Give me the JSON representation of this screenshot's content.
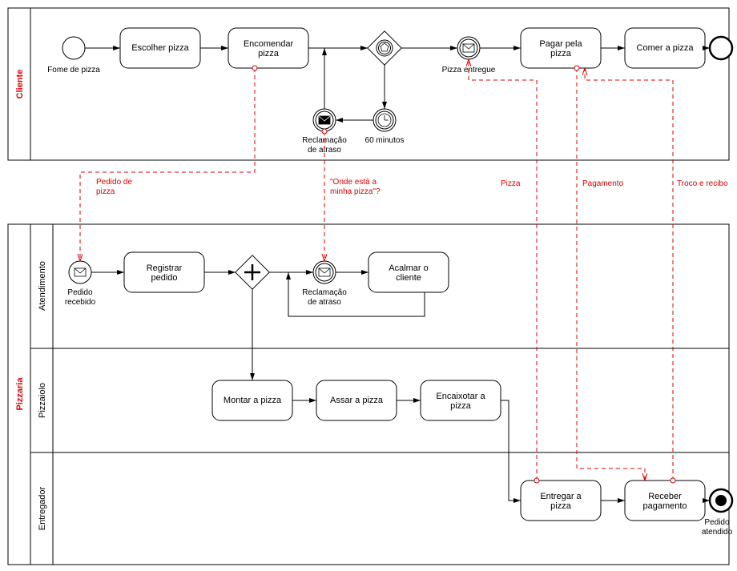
{
  "pool1": {
    "name": "Cliente"
  },
  "pool2": {
    "name": "Pizzaria"
  },
  "lanes": {
    "atendimento": "Atendimento",
    "pizzaiolo": "Pizzaiolo",
    "entregador": "Entregador"
  },
  "events": {
    "fome": "Fome de pizza",
    "pizzaEntregue": "Pizza entregue",
    "reclamacaoCliente1": "Reclamação",
    "reclamacaoCliente2": "de atraso",
    "timer": "60 minutos",
    "pedidoRecebido1": "Pedido",
    "pedidoRecebido2": "recebido",
    "reclamacaoAtend1": "Reclamação",
    "reclamacaoAtend2": "de atraso",
    "pedidoAtendido1": "Pedido",
    "pedidoAtendido2": "atendido"
  },
  "tasks": {
    "escolher": "Escolher pizza",
    "encomendar1": "Encomendar",
    "encomendar2": "pizza",
    "pagar1": "Pagar pela",
    "pagar2": "pizza",
    "comer": "Comer a pizza",
    "registrar1": "Registrar",
    "registrar2": "pedido",
    "acalmar1": "Acalmar o",
    "acalmar2": "cliente",
    "montar": "Montar a pizza",
    "assar": "Assar a pizza",
    "encaixotar1": "Encaixotar a",
    "encaixotar2": "pizza",
    "entregar1": "Entregar a",
    "entregar2": "pizza",
    "receber1": "Receber",
    "receber2": "pagamento"
  },
  "messages": {
    "pedido1": "Pedido de",
    "pedido2": "pizza",
    "onde1": "\"Onde está a",
    "onde2": "minha pizza\"?",
    "pizza": "Pizza",
    "pagamento": "Pagamento",
    "troco": "Troco e recibo"
  }
}
